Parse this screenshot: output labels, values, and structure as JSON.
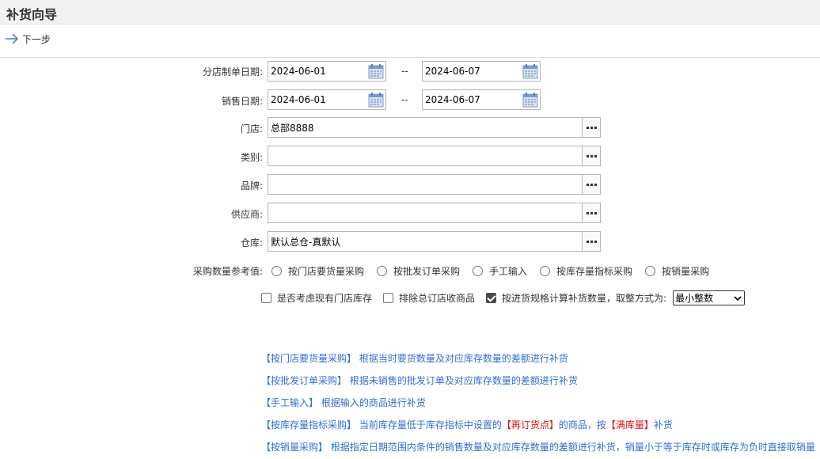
{
  "window": {
    "title": "补货向导"
  },
  "toolbar": {
    "next_label": "下一步"
  },
  "form": {
    "order_date": {
      "label": "分店制单日期:",
      "from": "2024-06-01",
      "to": "2024-06-07",
      "separator": "--"
    },
    "sales_date": {
      "label": "销售日期:",
      "from": "2024-06-01",
      "to": "2024-06-07",
      "separator": "--"
    },
    "store": {
      "label": "门店:",
      "value": "总部8888"
    },
    "category": {
      "label": "类别:",
      "value": ""
    },
    "brand": {
      "label": "品牌:",
      "value": ""
    },
    "supplier": {
      "label": "供应商:",
      "value": ""
    },
    "warehouse": {
      "label": "仓库:",
      "value": "默认总仓-真默认"
    },
    "purchase_ref": {
      "label": "采购数量参考值:",
      "options": [
        "按门店要货量采购",
        "按批发订单采购",
        "手工输入",
        "按库存量指标采购",
        "按销量采购"
      ]
    },
    "checks": [
      {
        "label": "是否考虑现有门店库存",
        "checked": false
      },
      {
        "label": "排除总订店收商品",
        "checked": false
      },
      {
        "label": "按进货规格计算补货数量，取整方式为:",
        "checked": true
      }
    ],
    "rounding": {
      "selected": "最小整数"
    }
  },
  "help": [
    {
      "tag": "【按门店要货量采购】",
      "text": " 根据当时要货数量及对应库存数量的差额进行补货"
    },
    {
      "tag": "【按批发订单采购】",
      "text": " 根据未销售的批发订单及对应库存数量的差额进行补货"
    },
    {
      "tag": "【手工输入】",
      "text": " 根据输入的商品进行补货"
    },
    {
      "tag": "【按库存量指标采购】",
      "text1": " 当前库存量低于库存指标中设置的",
      "red1": "【再订货点】",
      "text2": "的商品，按",
      "red2": "【满库量】",
      "text3": "补货"
    },
    {
      "tag": "【按销量采购】",
      "text": " 根据指定日期范围内条件的销售数量及对应库存数量的差额进行补货，销量小于等于库存时或库存为负时直接取销量"
    }
  ],
  "colors": {
    "help_text": "#2f6fd6",
    "highlight_red": "#e01010",
    "icon_blue": "#5b7fbf"
  }
}
